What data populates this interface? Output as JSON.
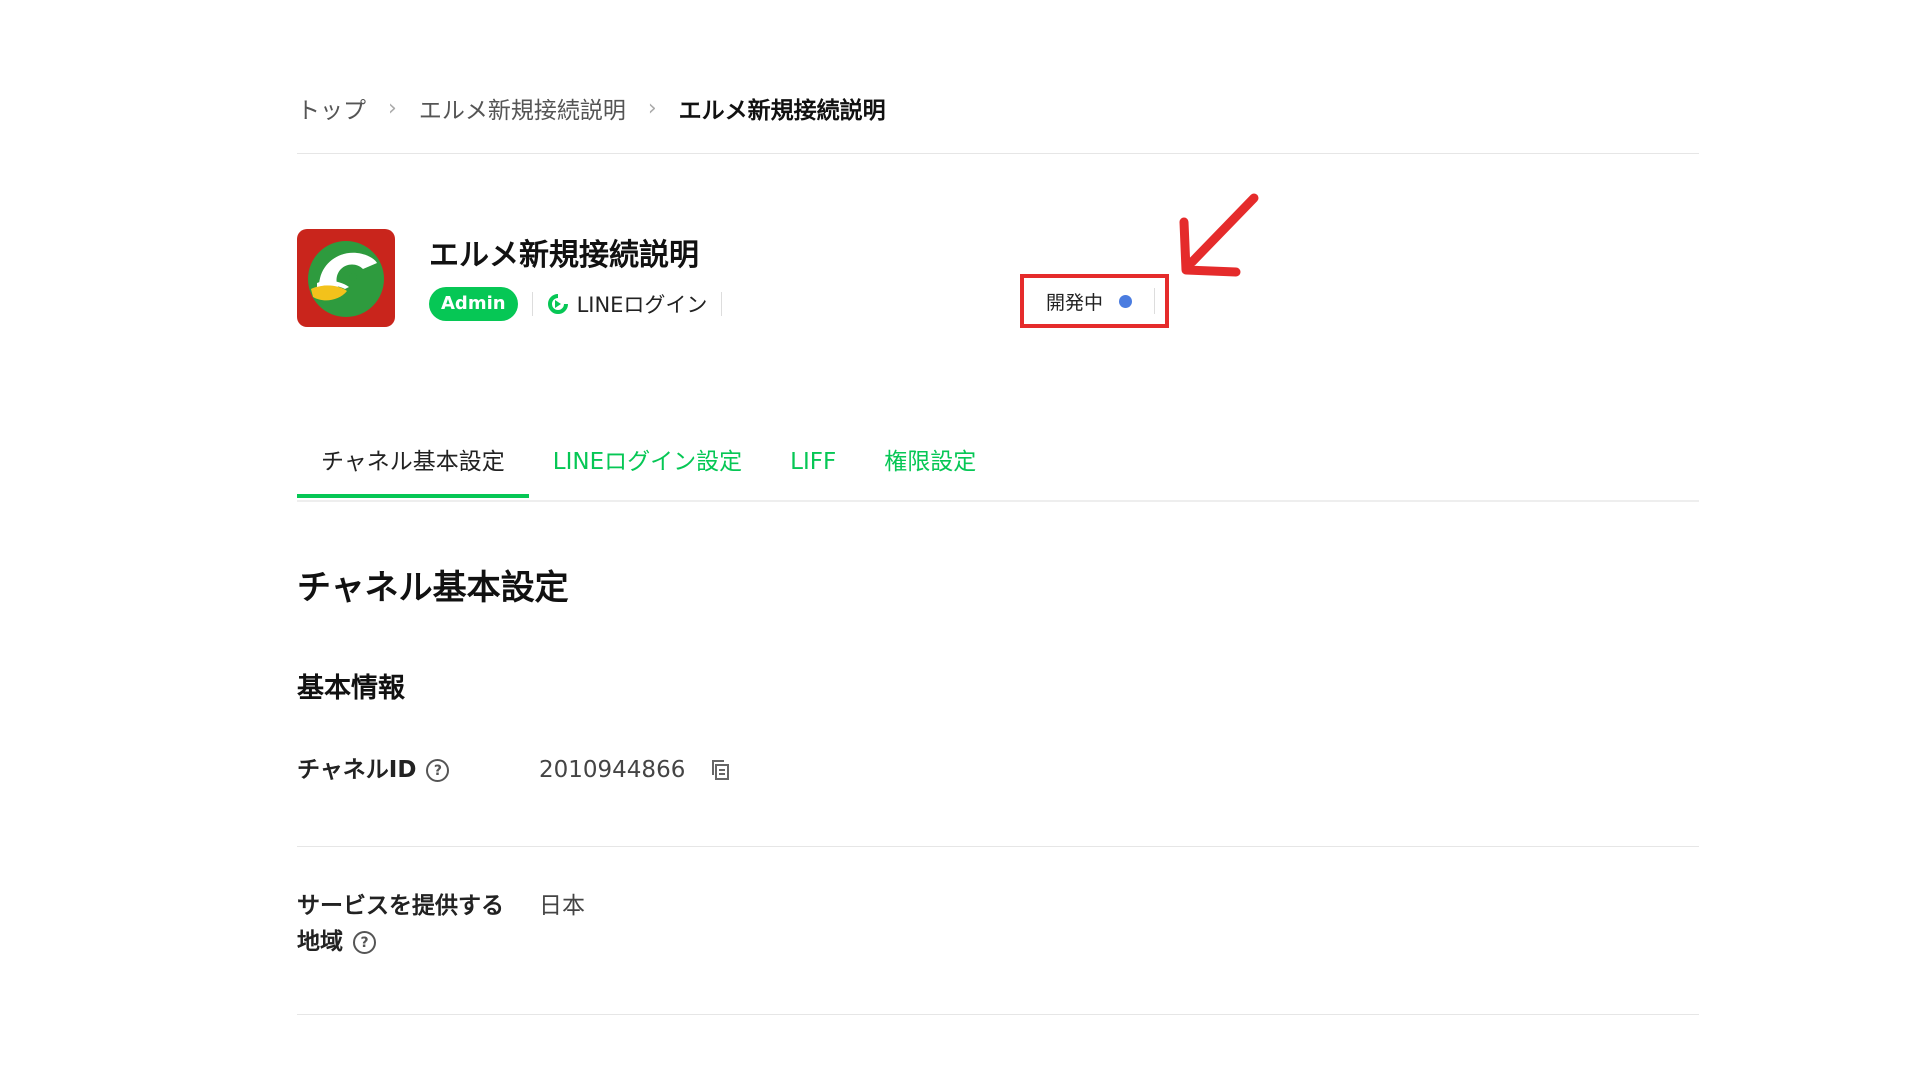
{
  "breadcrumb": {
    "items": [
      "トップ",
      "エルメ新規接続説明"
    ],
    "current": "エルメ新規接続説明",
    "separator": "›"
  },
  "channel": {
    "title": "エルメ新規接続説明",
    "role_badge": "Admin",
    "login_type": "LINEログイン",
    "status": "開発中",
    "icon": "channel-app-icon"
  },
  "tabs": [
    {
      "label": "チャネル基本設定",
      "active": true
    },
    {
      "label": "LINEログイン設定",
      "active": false
    },
    {
      "label": "LIFF",
      "active": false
    },
    {
      "label": "権限設定",
      "active": false
    }
  ],
  "section": {
    "title": "チャネル基本設定",
    "subtitle": "基本情報"
  },
  "fields": {
    "channel_id": {
      "label": "チャネルID",
      "value": "2010944866"
    },
    "region": {
      "label_line1": "サービスを提供する",
      "label_line2": "地域",
      "value": "日本"
    }
  },
  "colors": {
    "accent": "#06c755",
    "highlight": "#e52b2b",
    "status_dot": "#4a7ce0"
  }
}
